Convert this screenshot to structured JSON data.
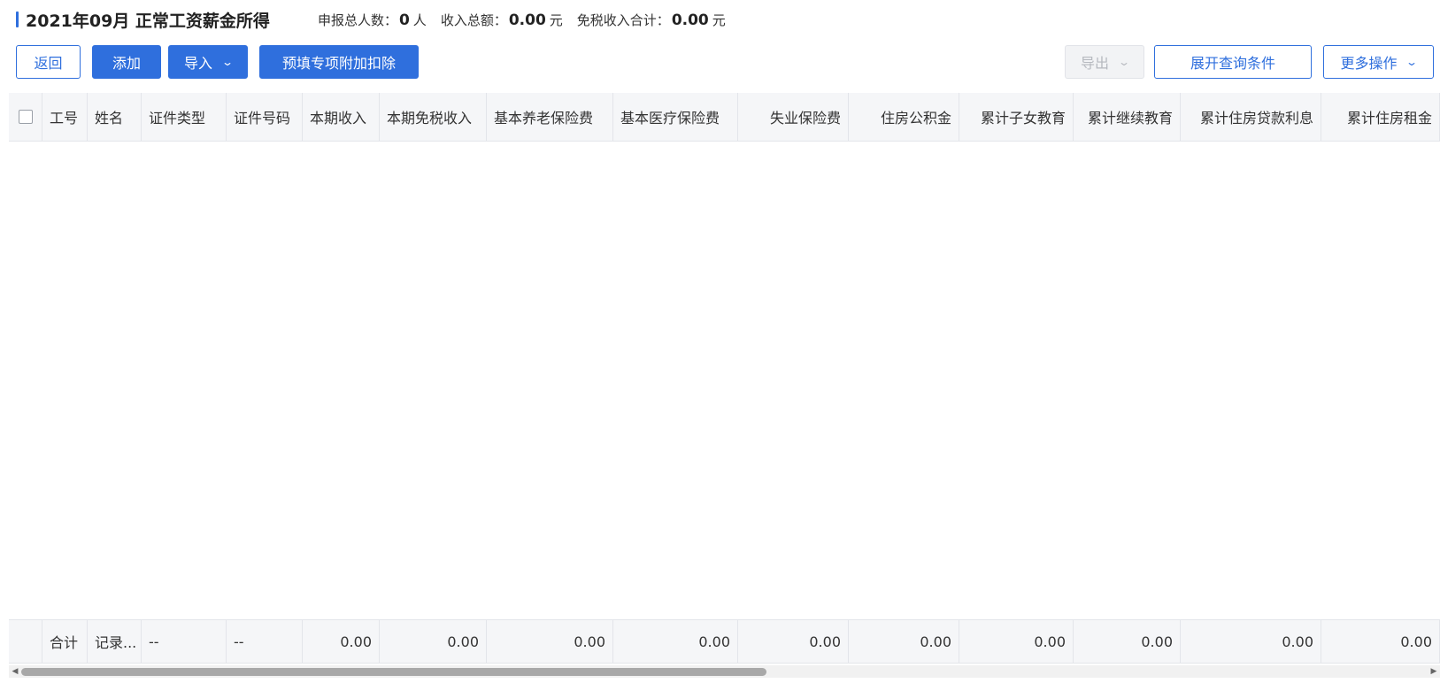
{
  "header": {
    "title": "2021年09月 正常工资薪金所得",
    "stats": [
      {
        "label": "申报总人数：",
        "value": "0",
        "unit": "人"
      },
      {
        "label": "收入总额：",
        "value": "0.00",
        "unit": "元"
      },
      {
        "label": "免税收入合计：",
        "value": "0.00",
        "unit": "元"
      }
    ]
  },
  "toolbar": {
    "back_label": "返回",
    "add_label": "添加",
    "import_label": "导入",
    "prefill_label": "预填专项附加扣除",
    "export_label": "导出",
    "expand_query_label": "展开查询条件",
    "more_label": "更多操作"
  },
  "colors": {
    "accent": "#2f6fdd",
    "header_bg": "#f5f6f8",
    "border": "#e3e5ea"
  },
  "table": {
    "columns": [
      "工号",
      "姓名",
      "证件类型",
      "证件号码",
      "本期收入",
      "本期免税收入",
      "基本养老保险费",
      "基本医疗保险费",
      "失业保险费",
      "住房公积金",
      "累计子女教育",
      "累计继续教育",
      "累计住房贷款利息",
      "累计住房租金"
    ],
    "rows": [],
    "footer": [
      "合计",
      "记录...",
      "--",
      "--",
      "0.00",
      "0.00",
      "0.00",
      "0.00",
      "0.00",
      "0.00",
      "0.00",
      "0.00",
      "0.00",
      "0.00"
    ]
  },
  "icons": {
    "dropdown": "chevron-down-icon",
    "scroll_left": "arrow-left-icon",
    "scroll_right": "arrow-right-icon"
  }
}
